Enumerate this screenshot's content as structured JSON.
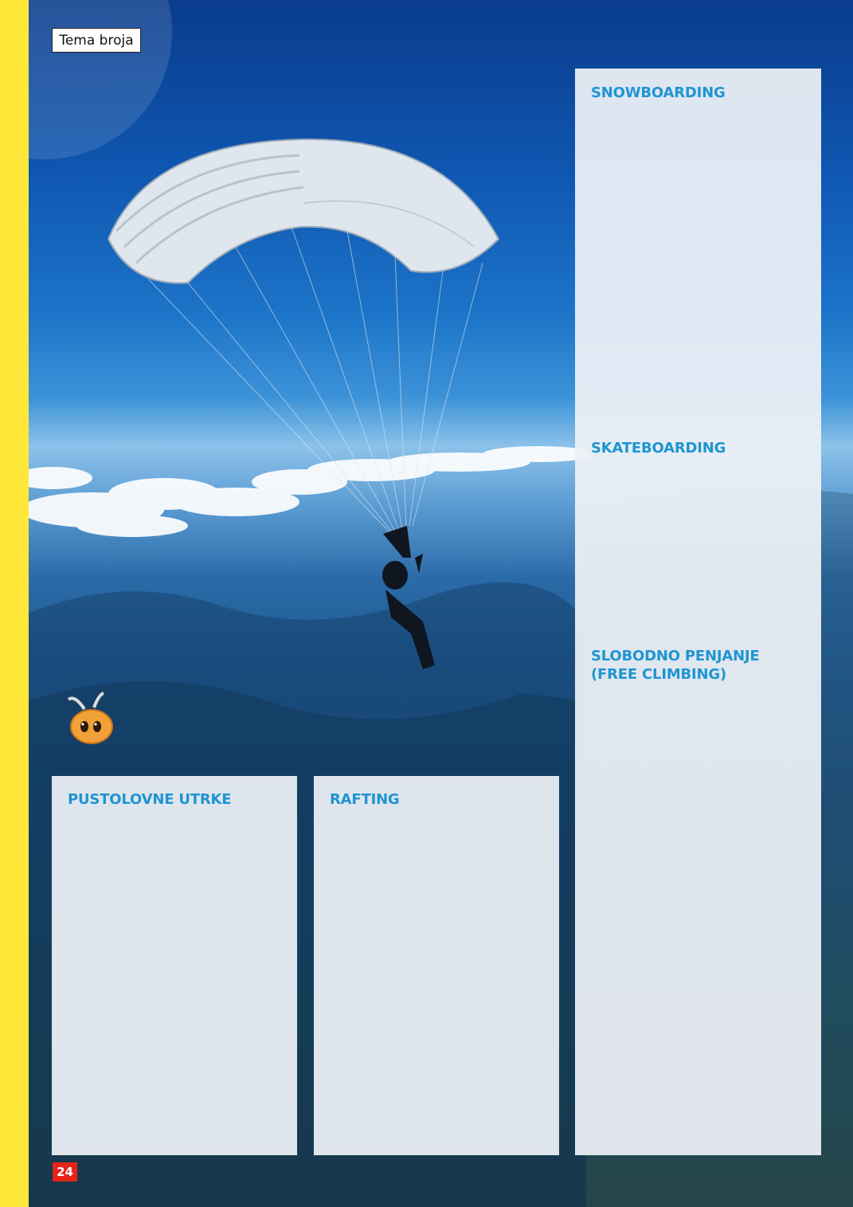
{
  "section_tag": "Tema broja",
  "headings": {
    "snowboarding": "SNOWBOARDING",
    "skateboarding": "SKATEBOARDING",
    "climbing_line1": "SLOBODNO PENJANJE",
    "climbing_line2": "(FREE CLIMBING)",
    "adventure_races": "PUSTOLOVNE UTRKE",
    "rafting": "RAFTING"
  },
  "page_number": "24",
  "colors": {
    "accent_stripe": "#ffe83a",
    "heading_blue": "#1f95d2",
    "page_number_red": "#e52418"
  },
  "icons": {
    "mascot": "bee-mascot-icon"
  }
}
